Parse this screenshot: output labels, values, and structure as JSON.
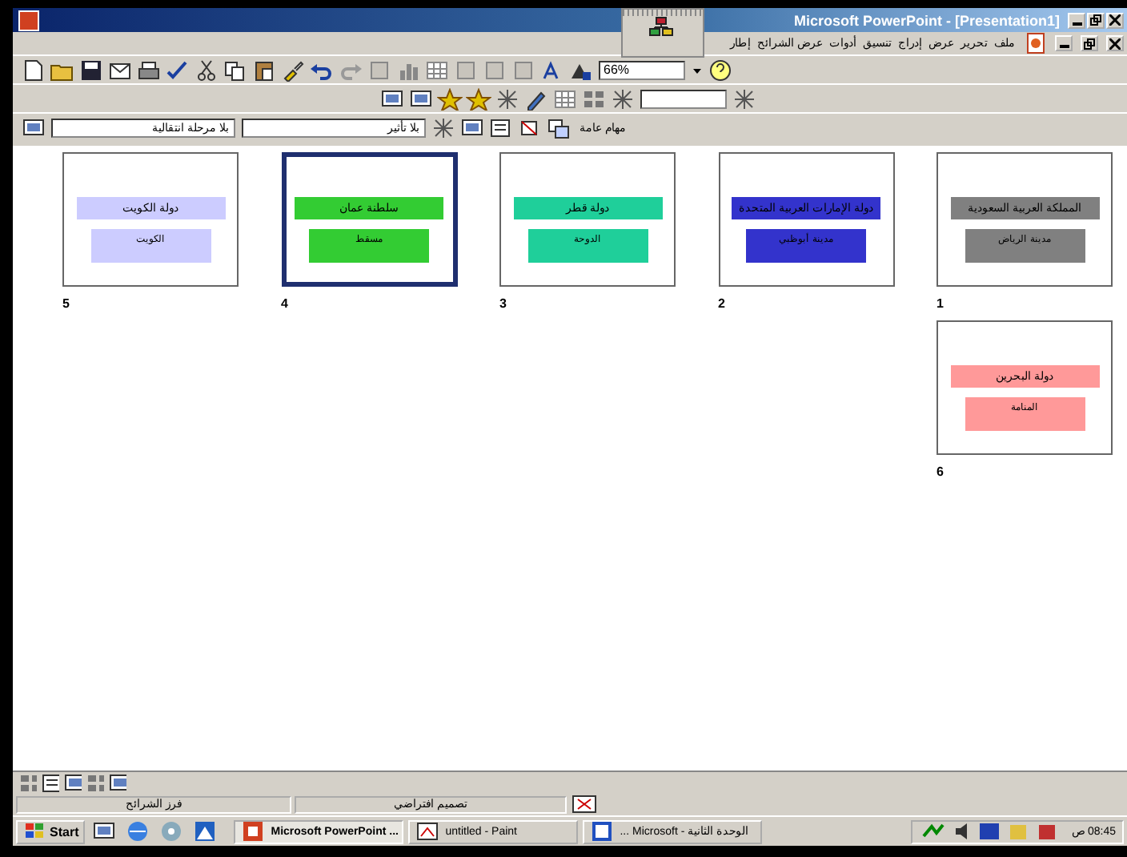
{
  "window": {
    "title": "Microsoft PowerPoint - [Presentation1]"
  },
  "menu": [
    "ملف",
    "تحرير",
    "عرض",
    "إدراج",
    "تنسيق",
    "أدوات",
    "عرض الشرائح",
    "إطار"
  ],
  "toolbar": {
    "zoom": "66%"
  },
  "sorter_toolbar": {
    "transition": "بلا مرحلة انتقالية",
    "effect": "بلا تأثير",
    "tasks": "مهام عامة"
  },
  "slides": [
    {
      "number": "1",
      "title": "المملكة العربية السعودية",
      "subtitle": "مدينة الرياض",
      "color": "#808080",
      "selected": false
    },
    {
      "number": "2",
      "title": "دولة الإمارات العربية المتحدة",
      "subtitle": "مدينة أبوظبي",
      "color": "#3333cc",
      "selected": false
    },
    {
      "number": "3",
      "title": "دولة قطر",
      "subtitle": "الدوحة",
      "color": "#1fcf9a",
      "selected": false
    },
    {
      "number": "4",
      "title": "سلطنة عمان",
      "subtitle": "مسقط",
      "color": "#33cc33",
      "selected": true
    },
    {
      "number": "5",
      "title": "دولة الكويت",
      "subtitle": "الكويت",
      "color": "#ccccff",
      "selected": false
    },
    {
      "number": "6",
      "title": "دولة البحرين",
      "subtitle": "المنامة",
      "color": "#ff9999",
      "selected": false
    }
  ],
  "status_bar": [
    "تصميم افتراضي",
    "فرز الشرائح"
  ],
  "taskbar": {
    "start": "Start",
    "buttons": [
      {
        "label": "الوحدة الثانية - Microsoft ...",
        "selected": false
      },
      {
        "label": "untitled - Paint",
        "selected": false
      },
      {
        "label": "Microsoft PowerPoint ...",
        "selected": true
      }
    ],
    "clock": "08:45 ص"
  }
}
